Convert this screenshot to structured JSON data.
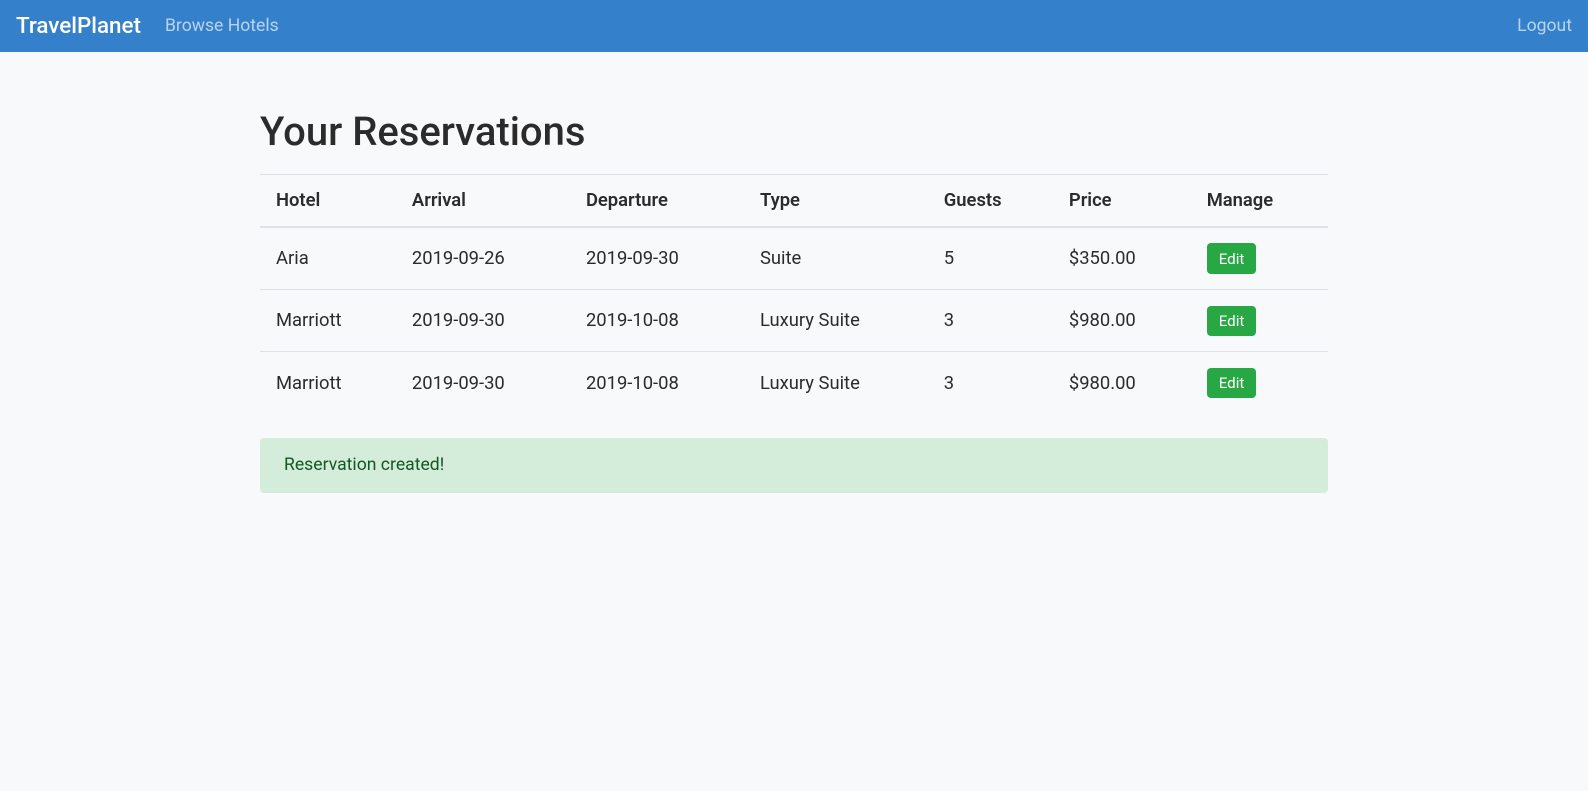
{
  "navbar": {
    "brand": "TravelPlanet",
    "browse_hotels": "Browse Hotels",
    "logout": "Logout"
  },
  "page": {
    "title": "Your Reservations"
  },
  "table": {
    "headers": {
      "hotel": "Hotel",
      "arrival": "Arrival",
      "departure": "Departure",
      "type": "Type",
      "guests": "Guests",
      "price": "Price",
      "manage": "Manage"
    },
    "edit_label": "Edit",
    "rows": [
      {
        "hotel": "Aria",
        "arrival": "2019-09-26",
        "departure": "2019-09-30",
        "type": "Suite",
        "guests": "5",
        "price": "$350.00"
      },
      {
        "hotel": "Marriott",
        "arrival": "2019-09-30",
        "departure": "2019-10-08",
        "type": "Luxury Suite",
        "guests": "3",
        "price": "$980.00"
      },
      {
        "hotel": "Marriott",
        "arrival": "2019-09-30",
        "departure": "2019-10-08",
        "type": "Luxury Suite",
        "guests": "3",
        "price": "$980.00"
      }
    ]
  },
  "alert": {
    "message": "Reservation created!"
  }
}
